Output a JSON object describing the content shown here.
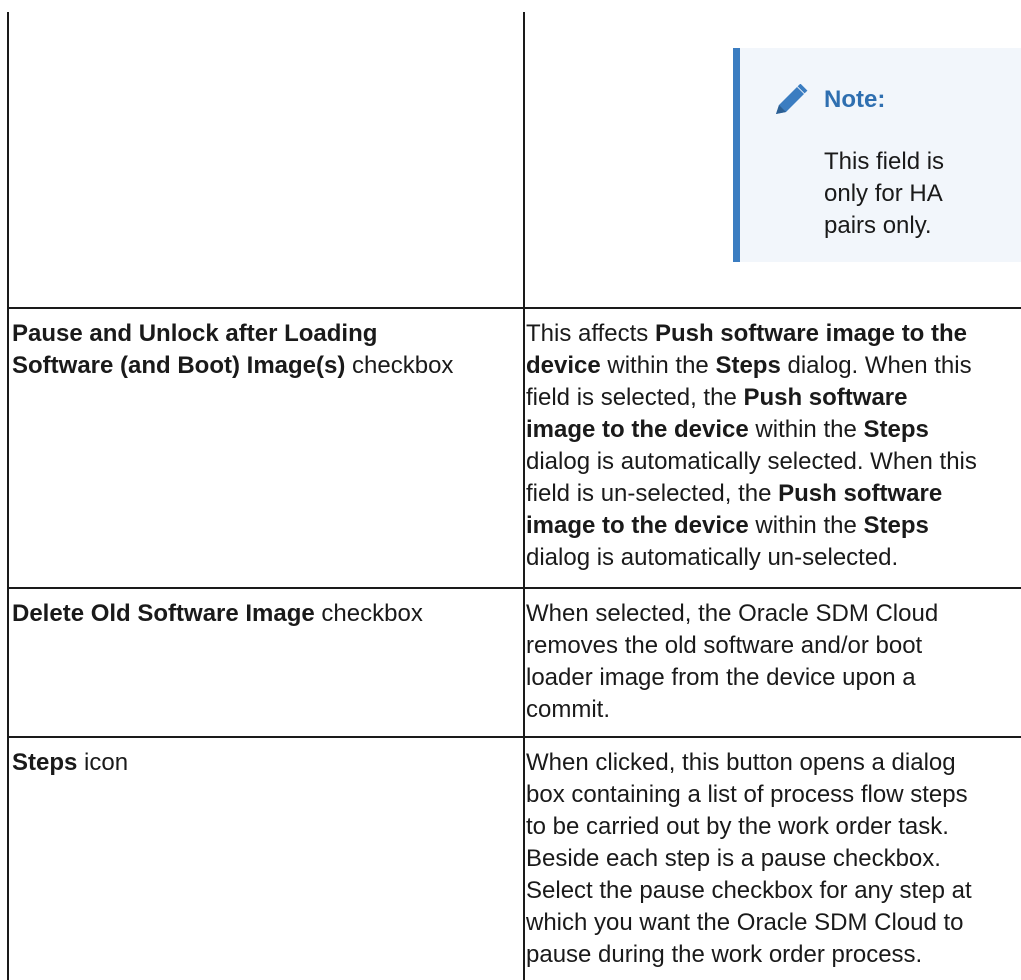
{
  "note": {
    "title": "Note:",
    "body_lines": [
      "This field is",
      "only for HA",
      "pairs only."
    ]
  },
  "rows": [
    {
      "left_bold": [
        "Pause and Unlock after Loading",
        "Software (and Boot) Image(s)"
      ],
      "left_suffix": " checkbox",
      "right_lines": [
        [
          {
            "t": "This affects ",
            "b": false
          },
          {
            "t": "Push software image to the",
            "b": true
          }
        ],
        [
          {
            "t": "device",
            "b": true
          },
          {
            "t": " within the ",
            "b": false
          },
          {
            "t": "Steps",
            "b": true
          },
          {
            "t": " dialog. When this",
            "b": false
          }
        ],
        [
          {
            "t": "field is selected, the ",
            "b": false
          },
          {
            "t": "Push software",
            "b": true
          }
        ],
        [
          {
            "t": "image to the device",
            "b": true
          },
          {
            "t": " within the ",
            "b": false
          },
          {
            "t": "Steps",
            "b": true
          }
        ],
        [
          {
            "t": "dialog is automatically selected. When this",
            "b": false
          }
        ],
        [
          {
            "t": "field is un-selected, the ",
            "b": false
          },
          {
            "t": "Push software",
            "b": true
          }
        ],
        [
          {
            "t": "image to the device",
            "b": true
          },
          {
            "t": " within the ",
            "b": false
          },
          {
            "t": "Steps",
            "b": true
          }
        ],
        [
          {
            "t": "dialog is automatically un-selected.",
            "b": false
          }
        ]
      ]
    },
    {
      "left_bold_inline": "Delete Old Software Image",
      "left_suffix": " checkbox",
      "right_lines": [
        [
          {
            "t": "When selected, the Oracle SDM Cloud",
            "b": false
          }
        ],
        [
          {
            "t": "removes the old software and/or boot",
            "b": false
          }
        ],
        [
          {
            "t": "loader image from the device upon a",
            "b": false
          }
        ],
        [
          {
            "t": "commit.",
            "b": false
          }
        ]
      ]
    },
    {
      "left_bold_inline": "Steps",
      "left_suffix": " icon",
      "right_lines": [
        [
          {
            "t": "When clicked, this button opens a dialog",
            "b": false
          }
        ],
        [
          {
            "t": "box containing a list of process flow steps",
            "b": false
          }
        ],
        [
          {
            "t": "to be carried out by the work order task.",
            "b": false
          }
        ],
        [
          {
            "t": "Beside each step is a pause checkbox.",
            "b": false
          }
        ],
        [
          {
            "t": "Select the pause checkbox for any step at",
            "b": false
          }
        ],
        [
          {
            "t": "which you want the Oracle SDM Cloud to",
            "b": false
          }
        ],
        [
          {
            "t": "pause during the work order process.",
            "b": false
          }
        ]
      ]
    }
  ]
}
